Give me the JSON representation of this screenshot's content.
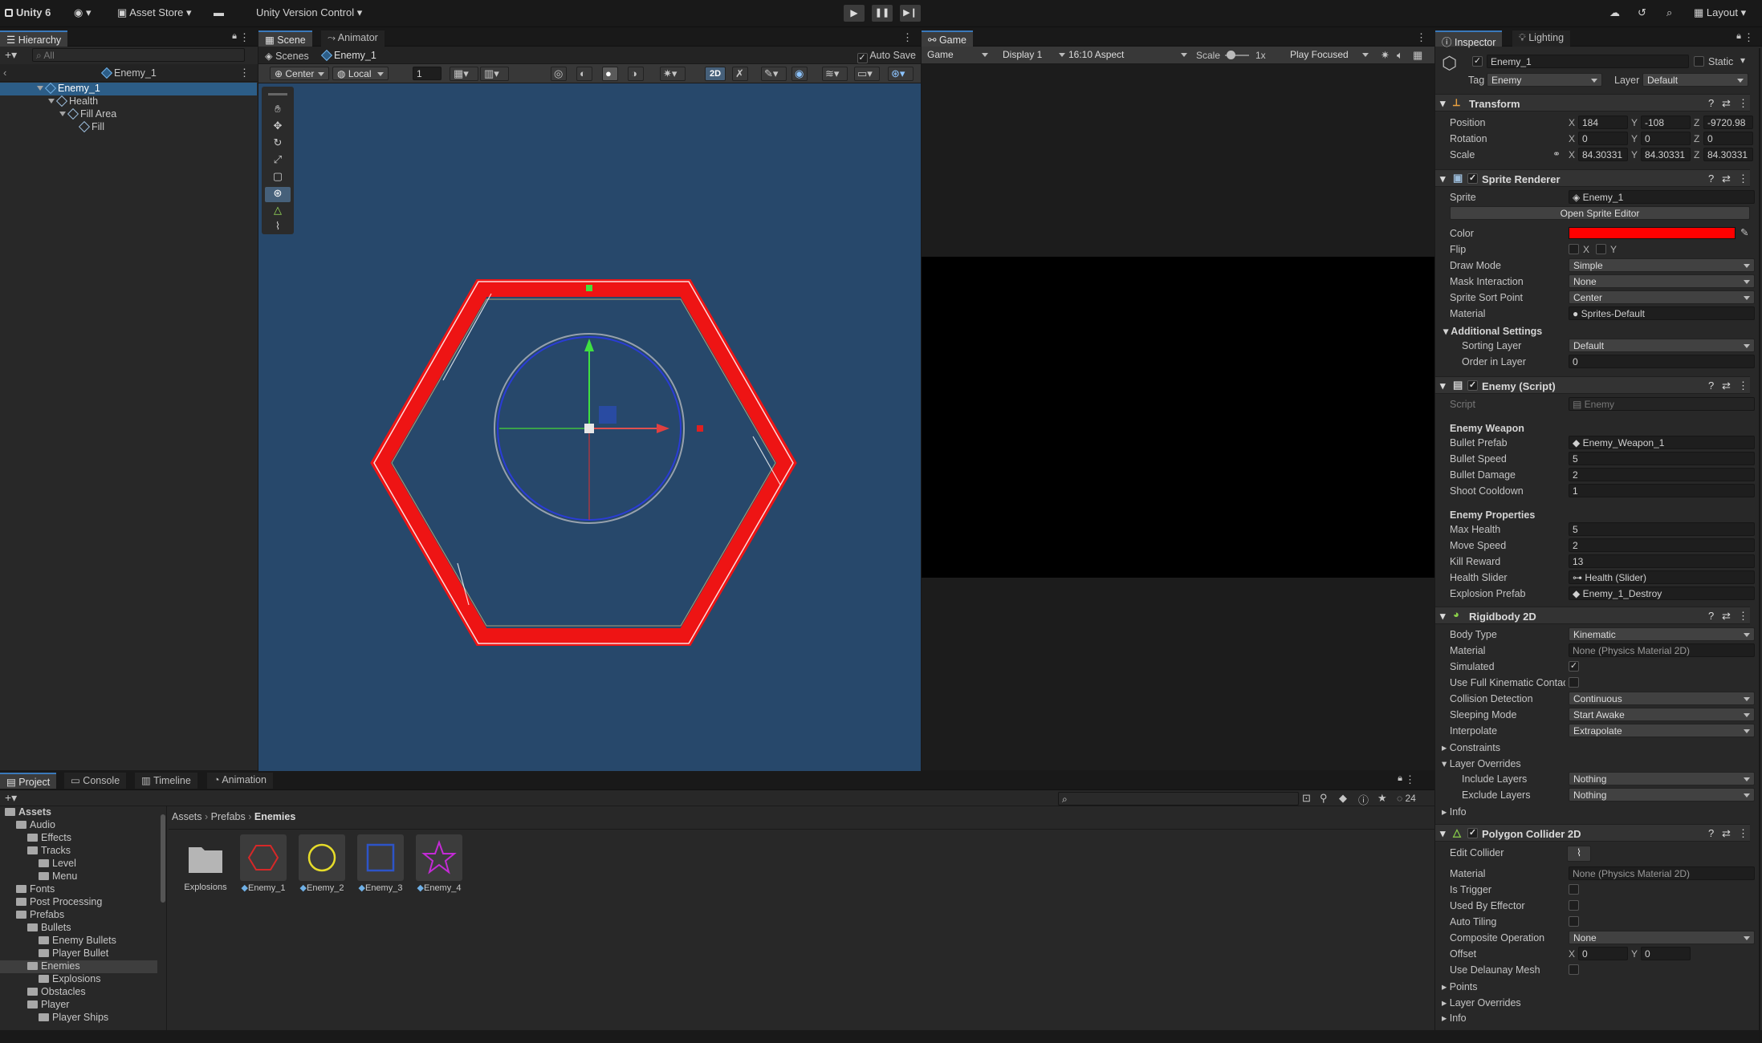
{
  "toolbar": {
    "account": "Unity 6",
    "asset_store": "Asset Store",
    "version_control": "Unity Version Control",
    "layout": "Layout"
  },
  "hierarchy": {
    "tab": "Hierarchy",
    "search_placeholder": "All",
    "scene_root": "Enemy_1",
    "rows": [
      {
        "label": "Enemy_1"
      },
      {
        "label": "Health"
      },
      {
        "label": "Fill Area"
      },
      {
        "label": "Fill"
      }
    ]
  },
  "scene": {
    "tabs": [
      "Scene",
      "Animator"
    ],
    "breadcrumb_root": "Scenes",
    "breadcrumb_item": "Enemy_1",
    "auto_save": "Auto Save",
    "pivot": "Center",
    "space": "Local",
    "grid_value": "1",
    "mode_2d": "2D"
  },
  "game": {
    "tab": "Game",
    "view": "Game",
    "display": "Display 1",
    "aspect": "16:10 Aspect",
    "scale_label": "Scale",
    "scale_value": "1x",
    "play_mode": "Play Focused"
  },
  "inspector": {
    "tabs": [
      "Inspector",
      "Lighting"
    ],
    "object_name": "Enemy_1",
    "static_label": "Static",
    "tag_label": "Tag",
    "tag": "Enemy",
    "layer_label": "Layer",
    "layer": "Default",
    "transform": {
      "title": "Transform",
      "position_label": "Position",
      "position": [
        "184",
        "-108",
        "-9720.98"
      ],
      "rotation_label": "Rotation",
      "rotation": [
        "0",
        "0",
        "0"
      ],
      "scale_label": "Scale",
      "scale": [
        "84.30331",
        "84.30331",
        "84.30331"
      ]
    },
    "sprite_renderer": {
      "title": "Sprite Renderer",
      "sprite_label": "Sprite",
      "sprite": "Enemy_1",
      "open_editor": "Open Sprite Editor",
      "color_label": "Color",
      "color": "#ff0000",
      "flip_label": "Flip",
      "flip_x": "X",
      "flip_y": "Y",
      "draw_mode_label": "Draw Mode",
      "draw_mode": "Simple",
      "mask_label": "Mask Interaction",
      "mask": "None",
      "sort_point_label": "Sprite Sort Point",
      "sort_point": "Center",
      "material_label": "Material",
      "material": "Sprites-Default",
      "additional": "Additional Settings",
      "sorting_layer_label": "Sorting Layer",
      "sorting_layer": "Default",
      "order_label": "Order in Layer",
      "order": "0"
    },
    "enemy_script": {
      "title": "Enemy (Script)",
      "script_label": "Script",
      "script": "Enemy",
      "weapon_section": "Enemy Weapon",
      "bullet_prefab_label": "Bullet Prefab",
      "bullet_prefab": "Enemy_Weapon_1",
      "bullet_speed_label": "Bullet Speed",
      "bullet_speed": "5",
      "bullet_damage_label": "Bullet Damage",
      "bullet_damage": "2",
      "shoot_cooldown_label": "Shoot Cooldown",
      "shoot_cooldown": "1",
      "props_section": "Enemy Properties",
      "max_health_label": "Max Health",
      "max_health": "5",
      "move_speed_label": "Move Speed",
      "move_speed": "2",
      "kill_reward_label": "Kill Reward",
      "kill_reward": "13",
      "health_slider_label": "Health Slider",
      "health_slider": "Health (Slider)",
      "explosion_label": "Explosion Prefab",
      "explosion": "Enemy_1_Destroy"
    },
    "rigidbody": {
      "title": "Rigidbody 2D",
      "body_type_label": "Body Type",
      "body_type": "Kinematic",
      "material_label": "Material",
      "material": "None (Physics Material 2D)",
      "simulated_label": "Simulated",
      "full_kinematic_label": "Use Full Kinematic Contac",
      "collision_label": "Collision Detection",
      "collision": "Continuous",
      "sleeping_label": "Sleeping Mode",
      "sleeping": "Start Awake",
      "interpolate_label": "Interpolate",
      "interpolate": "Extrapolate",
      "constraints": "Constraints",
      "layer_overrides": "Layer Overrides",
      "include_label": "Include Layers",
      "include": "Nothing",
      "exclude_label": "Exclude Layers",
      "exclude": "Nothing",
      "info": "Info"
    },
    "polygon": {
      "title": "Polygon Collider 2D",
      "edit_label": "Edit Collider",
      "material_label": "Material",
      "material": "None (Physics Material 2D)",
      "trigger_label": "Is Trigger",
      "effector_label": "Used By Effector",
      "tiling_label": "Auto Tiling",
      "composite_label": "Composite Operation",
      "composite": "None",
      "offset_label": "Offset",
      "offset": [
        "0",
        "0"
      ],
      "delaunay_label": "Use Delaunay Mesh",
      "points": "Points",
      "layer_overrides": "Layer Overrides",
      "info": "Info"
    }
  },
  "bottom": {
    "tabs": [
      "Project",
      "Console",
      "Timeline",
      "Animation"
    ],
    "hidden_count": "24",
    "breadcrumb": [
      "Assets",
      "Prefabs",
      "Enemies"
    ],
    "tree": [
      {
        "label": "Assets",
        "depth": 0,
        "bold": true
      },
      {
        "label": "Audio",
        "depth": 1
      },
      {
        "label": "Effects",
        "depth": 2
      },
      {
        "label": "Tracks",
        "depth": 2
      },
      {
        "label": "Level",
        "depth": 3
      },
      {
        "label": "Menu",
        "depth": 3
      },
      {
        "label": "Fonts",
        "depth": 1
      },
      {
        "label": "Post Processing",
        "depth": 1
      },
      {
        "label": "Prefabs",
        "depth": 1
      },
      {
        "label": "Bullets",
        "depth": 2
      },
      {
        "label": "Enemy Bullets",
        "depth": 3
      },
      {
        "label": "Player Bullet",
        "depth": 3
      },
      {
        "label": "Enemies",
        "depth": 2,
        "selected": true
      },
      {
        "label": "Explosions",
        "depth": 3
      },
      {
        "label": "Obstacles",
        "depth": 2
      },
      {
        "label": "Player",
        "depth": 2
      },
      {
        "label": "Player Ships",
        "depth": 3
      }
    ],
    "assets": [
      {
        "label": "Explosions",
        "kind": "folder"
      },
      {
        "label": "Enemy_1",
        "kind": "hexagon",
        "color": "#d62828"
      },
      {
        "label": "Enemy_2",
        "kind": "circle",
        "color": "#e6dc2a"
      },
      {
        "label": "Enemy_3",
        "kind": "square",
        "color": "#2d54c8"
      },
      {
        "label": "Enemy_4",
        "kind": "star",
        "color": "#c42ad6"
      }
    ]
  }
}
